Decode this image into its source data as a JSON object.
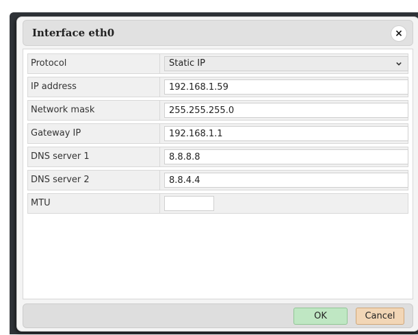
{
  "dialog": {
    "title": "Interface eth0",
    "close_glyph": "×"
  },
  "form": {
    "protocol": {
      "label": "Protocol",
      "value": "Static IP"
    },
    "ip_address": {
      "label": "IP address",
      "value": "192.168.1.59"
    },
    "network_mask": {
      "label": "Network mask",
      "value": "255.255.255.0"
    },
    "gateway_ip": {
      "label": "Gateway IP",
      "value": "192.168.1.1"
    },
    "dns_server_1": {
      "label": "DNS server 1",
      "value": "8.8.8.8"
    },
    "dns_server_2": {
      "label": "DNS server 2",
      "value": "8.8.4.4"
    },
    "mtu": {
      "label": "MTU",
      "value": ""
    }
  },
  "buttons": {
    "ok_label": "OK",
    "cancel_label": "Cancel"
  },
  "icons": {
    "close": "close-icon",
    "dropdown": "chevron-down-icon"
  },
  "colors": {
    "ok_button": "#bfe7c3",
    "cancel_button": "#f2d6b6",
    "titlebar": "#e1e1e1",
    "row_background": "#f0f0f0"
  }
}
